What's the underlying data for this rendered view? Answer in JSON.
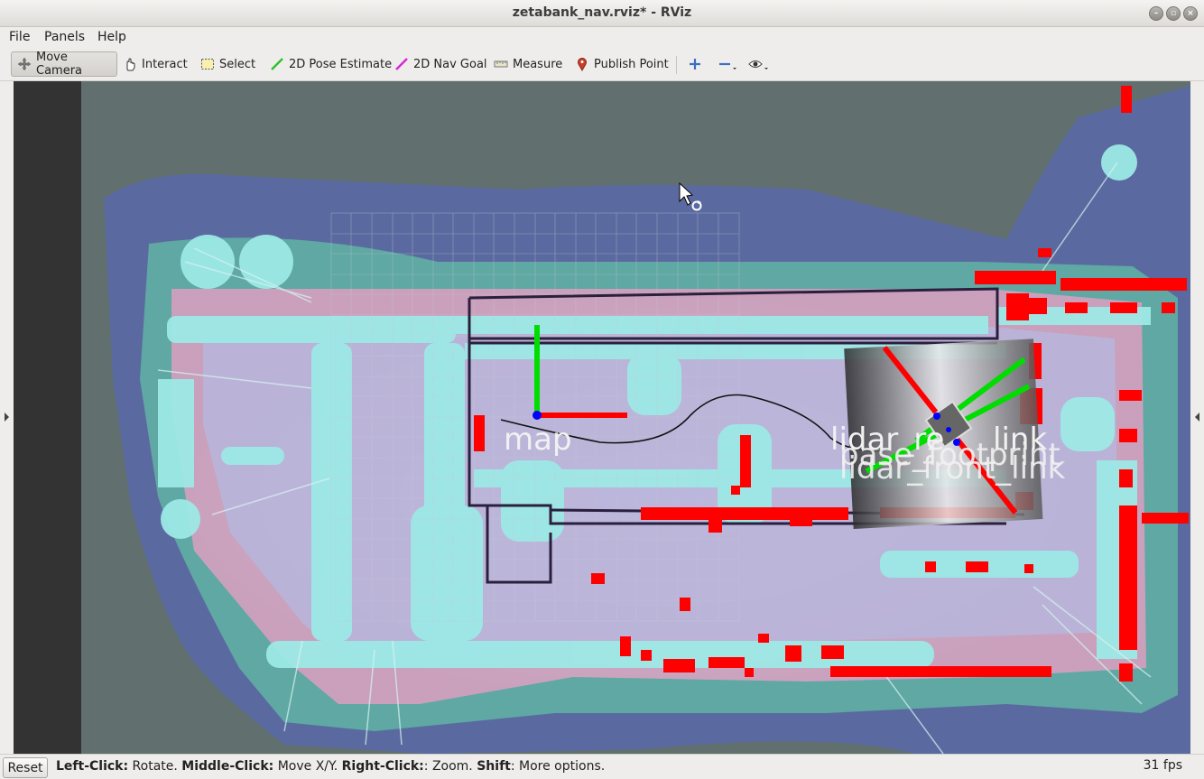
{
  "window": {
    "title": "zetabank_nav.rviz* - RViz"
  },
  "menu": [
    {
      "label": "File"
    },
    {
      "label": "Panels"
    },
    {
      "label": "Help"
    }
  ],
  "toolbar": {
    "move_camera": "Move Camera",
    "interact": "Interact",
    "select": "Select",
    "pose_estimate": "2D Pose Estimate",
    "nav_goal": "2D Nav Goal",
    "measure": "Measure",
    "publish_point": "Publish Point"
  },
  "viewport": {
    "frame_labels": {
      "map": "map",
      "lidar_rear": "lidar_re",
      "link": "link",
      "base_footprint": "base_footprint",
      "lidar_front": "lidar_front_link"
    },
    "colors": {
      "unknown": "#61706f",
      "free": "#b4c1c8",
      "inflation_outer": "#5a6aa0",
      "inflation_inner": "#5fa8a3",
      "obstacle_near": "#9de9e6",
      "laser": "#ff0000",
      "axis_x": "#ff0000",
      "axis_y": "#00dd00",
      "axis_z": "#0000ff"
    }
  },
  "status": {
    "reset_label": "Reset",
    "left_click_key": "Left-Click:",
    "left_click_action": " Rotate. ",
    "middle_click_key": "Middle-Click:",
    "middle_click_action": " Move X/Y. ",
    "right_click_key": "Right-Click:",
    "right_click_action": ": Zoom. ",
    "shift_key": "Shift",
    "shift_action": ": More options.",
    "fps": "31 fps"
  }
}
